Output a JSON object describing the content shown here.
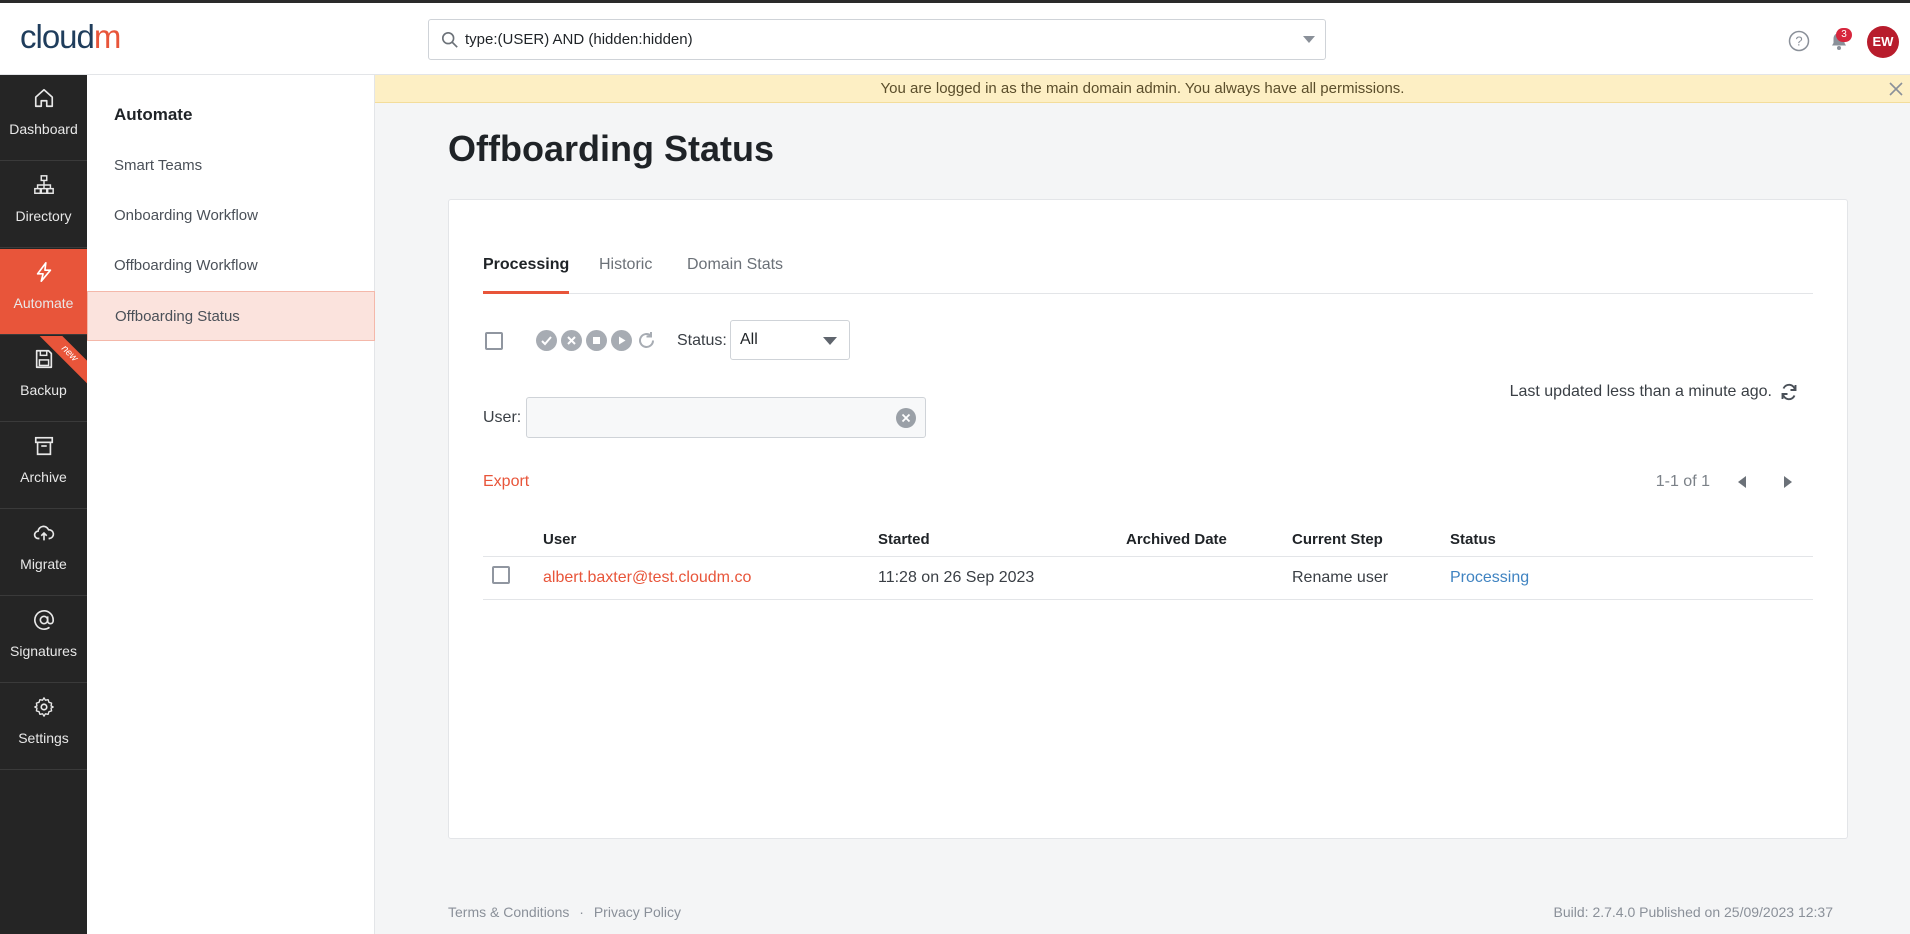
{
  "app": {
    "logo_main": "cloud",
    "logo_accent": "m",
    "search_value": "type:(USER) AND (hidden:hidden)",
    "notifications_count": "3",
    "avatar_initials": "EW"
  },
  "rail": {
    "items": [
      {
        "label": "Dashboard",
        "icon": "home-icon"
      },
      {
        "label": "Directory",
        "icon": "org-chart-icon"
      },
      {
        "label": "Automate",
        "icon": "lightning-icon"
      },
      {
        "label": "Backup",
        "icon": "floppy-icon",
        "ribbon": "new"
      },
      {
        "label": "Archive",
        "icon": "archive-box-icon"
      },
      {
        "label": "Migrate",
        "icon": "cloud-upload-icon"
      },
      {
        "label": "Signatures",
        "icon": "at-sign-icon"
      },
      {
        "label": "Settings",
        "icon": "gear-icon"
      }
    ],
    "active_index": 2
  },
  "subnav": {
    "heading": "Automate",
    "items": [
      "Smart Teams",
      "Onboarding Workflow",
      "Offboarding Workflow",
      "Offboarding Status"
    ],
    "active_index": 3
  },
  "banner": {
    "text": "You are logged in as the main domain admin. You always have all permissions."
  },
  "page": {
    "title": "Offboarding Status",
    "tabs": [
      "Processing",
      "Historic",
      "Domain Stats"
    ],
    "active_tab": 0,
    "status_label": "Status:",
    "status_value": "All",
    "user_label": "User:",
    "user_value": "",
    "last_updated": "Last updated less than a minute ago.",
    "export_label": "Export",
    "pagination": "1-1 of 1",
    "columns": [
      "User",
      "Started",
      "Archived Date",
      "Current Step",
      "Status"
    ],
    "rows": [
      {
        "user": "albert.baxter@test.cloudm.co",
        "started": "11:28 on 26 Sep 2023",
        "archived": "",
        "step": "Rename user",
        "status": "Processing"
      }
    ]
  },
  "footer": {
    "terms": "Terms & Conditions",
    "separator": "·",
    "privacy": "Privacy Policy",
    "build": "Build: 2.7.4.0 Published on 25/09/2023 12:37"
  },
  "colors": {
    "accent": "#e8553a",
    "rail_bg": "#252525",
    "banner_bg": "#fdefc4",
    "status_link": "#3f83c1"
  }
}
